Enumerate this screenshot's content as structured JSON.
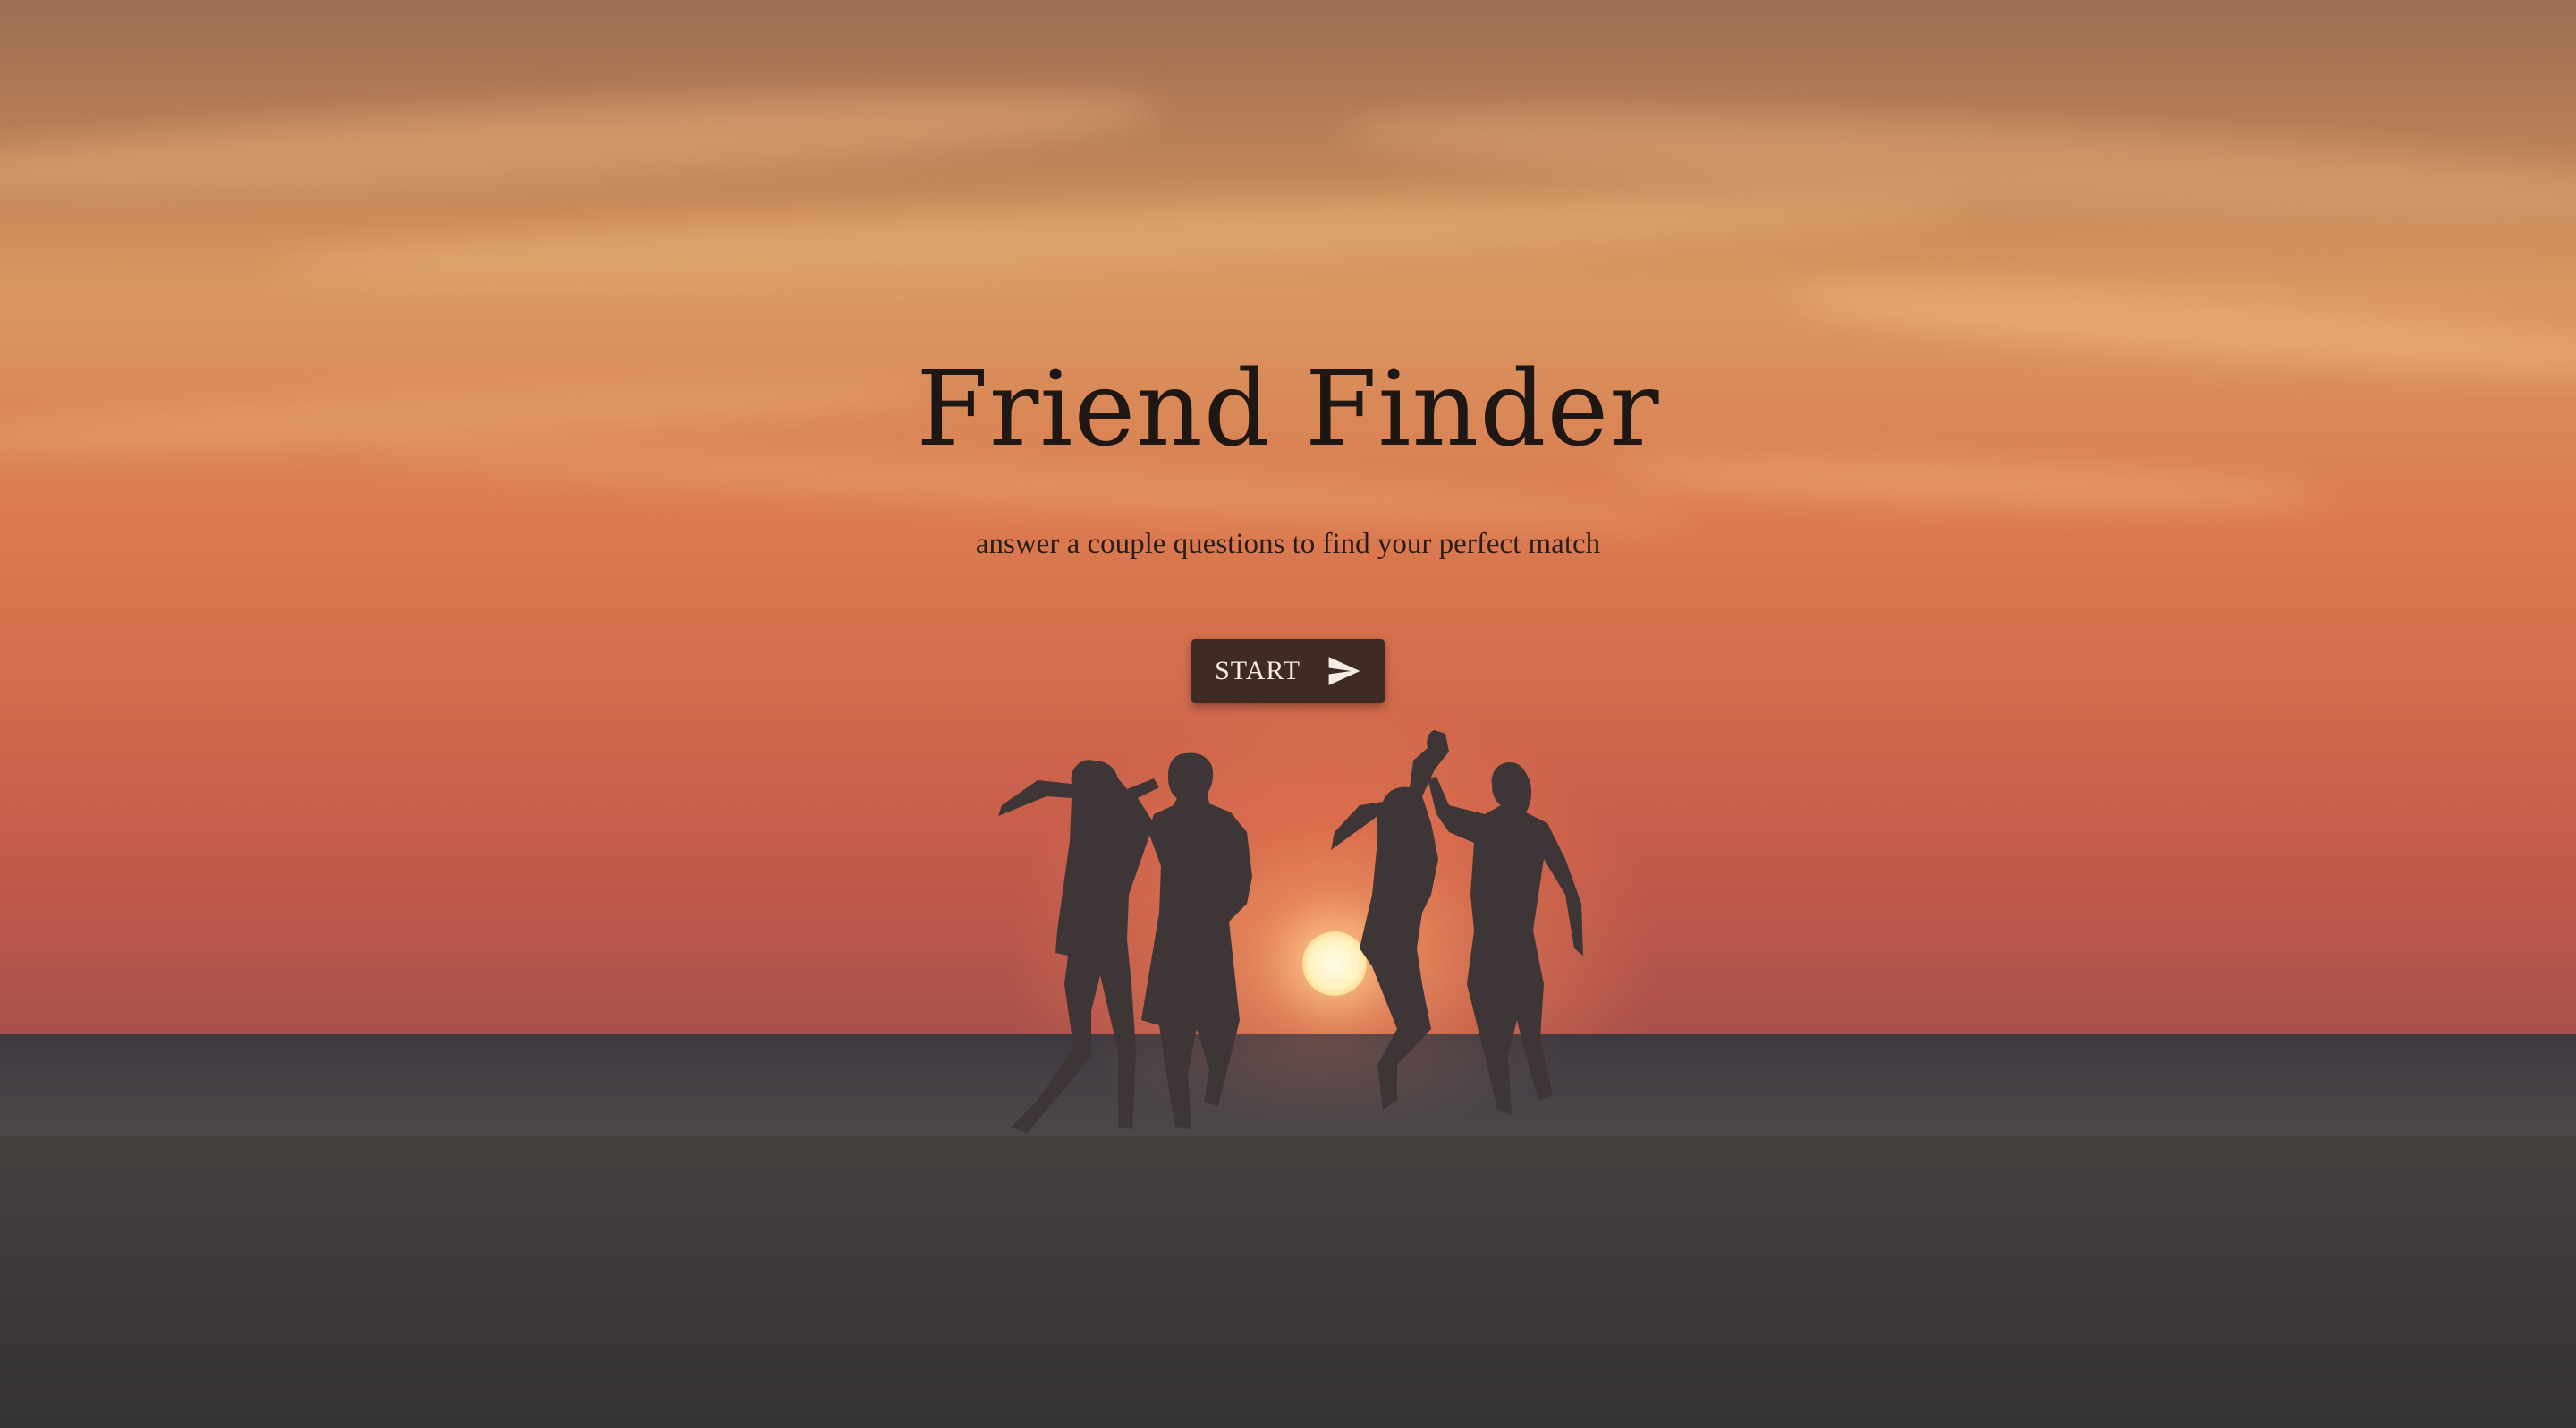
{
  "hero": {
    "title": "Friend Finder",
    "subtitle": "answer a couple questions to find your perfect match",
    "start_button": {
      "label": "START",
      "icon": "send-icon"
    }
  },
  "colors": {
    "button_bg": "#3f2b24",
    "button_text": "#f6ece6",
    "title_text": "#1e1714",
    "sky_orange": "#db7b50"
  }
}
